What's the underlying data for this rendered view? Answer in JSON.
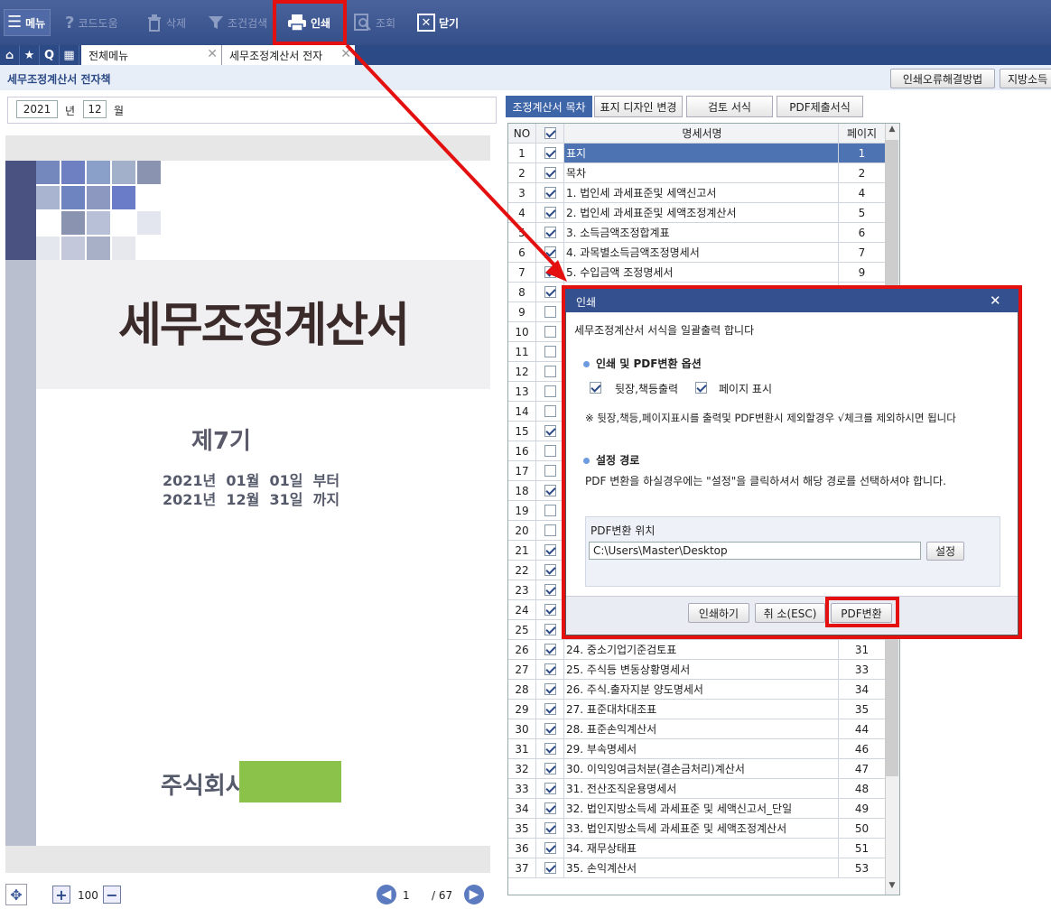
{
  "toolbar": {
    "menu": "메뉴",
    "code_help": "코드도움",
    "delete": "삭제",
    "search_cond": "조건검색",
    "print": "인쇄",
    "view": "조회",
    "close": "닫기"
  },
  "tabs": {
    "all_menu": "전체메뉴",
    "active_tab": "세무조정계산서 전자"
  },
  "page_title": "세무조정계산서 전자책",
  "right_buttons": {
    "print_error_help": "인쇄오류해결방법",
    "local_tax": "지방소득"
  },
  "date": {
    "year": "2021",
    "year_label": "년",
    "month": "12",
    "month_label": "월"
  },
  "cover": {
    "title": "세무조정계산서",
    "term": "제7기",
    "period_line1": "2021년  01월  01일  부터",
    "period_line2": "2021년  12월  31일  까지",
    "company": "주식회사"
  },
  "zoom": {
    "value": "100"
  },
  "pager": {
    "current": "1",
    "total": "/ 67"
  },
  "right_tabs": [
    "조정계산서 목차",
    "표지 디자인 변경",
    "검토 서식",
    "PDF제출서식"
  ],
  "grid": {
    "headers": {
      "no": "NO",
      "name": "명세서명",
      "page": "페이지"
    },
    "rows": [
      {
        "no": "1",
        "checked": true,
        "name": "표지",
        "page": "1",
        "selected": true
      },
      {
        "no": "2",
        "checked": true,
        "name": "목차",
        "page": "2"
      },
      {
        "no": "3",
        "checked": true,
        "name": "1. 법인세 과세표준및 세액신고서",
        "page": "4"
      },
      {
        "no": "4",
        "checked": true,
        "name": "2. 법인세 과세표준및 세액조정계산서",
        "page": "5"
      },
      {
        "no": "5",
        "checked": true,
        "name": "3. 소득금액조정합계표",
        "page": "6"
      },
      {
        "no": "6",
        "checked": true,
        "name": "4. 과목별소득금액조정명세서",
        "page": "7"
      },
      {
        "no": "7",
        "checked": true,
        "name": "5. 수입금액 조정명세서",
        "page": "9"
      },
      {
        "no": "8",
        "checked": true,
        "name": "",
        "page": ""
      },
      {
        "no": "9",
        "checked": false,
        "name": "",
        "page": ""
      },
      {
        "no": "10",
        "checked": false,
        "name": "",
        "page": ""
      },
      {
        "no": "11",
        "checked": false,
        "name": "",
        "page": ""
      },
      {
        "no": "12",
        "checked": false,
        "name": "",
        "page": ""
      },
      {
        "no": "13",
        "checked": false,
        "name": "",
        "page": ""
      },
      {
        "no": "14",
        "checked": false,
        "name": "",
        "page": ""
      },
      {
        "no": "15",
        "checked": true,
        "name": "",
        "page": ""
      },
      {
        "no": "16",
        "checked": false,
        "name": "",
        "page": ""
      },
      {
        "no": "17",
        "checked": false,
        "name": "",
        "page": ""
      },
      {
        "no": "18",
        "checked": true,
        "name": "",
        "page": ""
      },
      {
        "no": "19",
        "checked": false,
        "name": "",
        "page": ""
      },
      {
        "no": "20",
        "checked": false,
        "name": "",
        "page": ""
      },
      {
        "no": "21",
        "checked": true,
        "name": "",
        "page": ""
      },
      {
        "no": "22",
        "checked": true,
        "name": "",
        "page": ""
      },
      {
        "no": "23",
        "checked": true,
        "name": "",
        "page": ""
      },
      {
        "no": "24",
        "checked": true,
        "name": "",
        "page": ""
      },
      {
        "no": "25",
        "checked": true,
        "name": "",
        "page": ""
      },
      {
        "no": "26",
        "checked": true,
        "name": "24. 중소기업기준검토표",
        "page": "31"
      },
      {
        "no": "27",
        "checked": true,
        "name": "25. 주식등 변동상황명세서",
        "page": "33"
      },
      {
        "no": "28",
        "checked": true,
        "name": "26. 주식.출자지분 양도명세서",
        "page": "34"
      },
      {
        "no": "29",
        "checked": true,
        "name": "27. 표준대차대조표",
        "page": "35"
      },
      {
        "no": "30",
        "checked": true,
        "name": "28. 표준손익계산서",
        "page": "44"
      },
      {
        "no": "31",
        "checked": true,
        "name": "29. 부속명세서",
        "page": "46"
      },
      {
        "no": "32",
        "checked": true,
        "name": "30. 이익잉여금처분(결손금처리)계산서",
        "page": "47"
      },
      {
        "no": "33",
        "checked": true,
        "name": "31. 전산조직운용명세서",
        "page": "48"
      },
      {
        "no": "34",
        "checked": true,
        "name": "32. 법인지방소득세 과세표준 및 세액신고서_단일",
        "page": "49"
      },
      {
        "no": "35",
        "checked": true,
        "name": "33. 법인지방소득세 과세표준 및 세액조정계산서",
        "page": "50"
      },
      {
        "no": "36",
        "checked": true,
        "name": "34. 재무상태표",
        "page": "51"
      },
      {
        "no": "37",
        "checked": true,
        "name": "35. 손익계산서",
        "page": "53"
      }
    ]
  },
  "dialog": {
    "title": "인쇄",
    "close": "✕",
    "desc": "세무조정계산서 서식을 일괄출력 합니다",
    "section1": "인쇄 및 PDF변환 옵션",
    "opt_duplex": "뒷장,책등출력",
    "opt_pagenum": "페이지 표시",
    "note": "※ 뒷장,책등,페이지표시를 출력및 PDF변환시 제외할경우 √체크를 제외하시면 됩니다",
    "section2": "설정 경로",
    "path_desc": "PDF 변환을 하실경우에는 \"설정\"을 클릭하셔서 해당 경로를 선택하셔야 합니다.",
    "path_label": "PDF변환 위치",
    "path_value": "C:\\Users\\Master\\Desktop",
    "set_btn": "설정",
    "print_btn": "인쇄하기",
    "cancel_btn": "취 소(ESC)",
    "pdf_btn": "PDF변환"
  },
  "colors": {
    "toolbar": "#3b5998",
    "highlight": "#e41010",
    "company_mask": "#8bc34a",
    "selected_row": "#4d73b3"
  }
}
